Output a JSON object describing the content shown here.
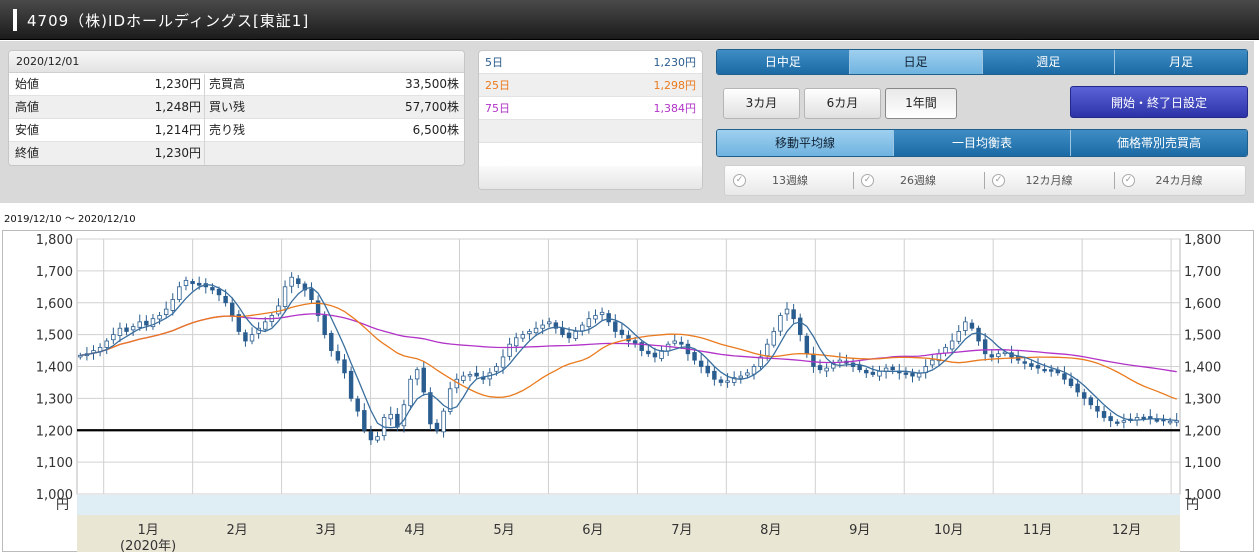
{
  "header": {
    "title": "4709（株)IDホールディングス[東証1]"
  },
  "quote": {
    "date": "2020/12/01",
    "rows": [
      {
        "label": "始値",
        "value": "1,230円",
        "label2": "売買高",
        "value2": "33,500株"
      },
      {
        "label": "高値",
        "value": "1,248円",
        "label2": "買い残",
        "value2": "57,700株"
      },
      {
        "label": "安値",
        "value": "1,214円",
        "label2": "売り残",
        "value2": "6,500株"
      },
      {
        "label": "終値",
        "value": "1,230円",
        "label2": "",
        "value2": ""
      }
    ]
  },
  "moving_averages": [
    {
      "label": "5日",
      "value": "1,230円",
      "color": "#2a5d8f"
    },
    {
      "label": "25日",
      "value": "1,298円",
      "color": "#ea7a1e"
    },
    {
      "label": "75日",
      "value": "1,384円",
      "color": "#b233c8"
    }
  ],
  "period_tabs": [
    "日中足",
    "日足",
    "週足",
    "月足"
  ],
  "period_tab_active": "日足",
  "range_buttons": [
    "3カ月",
    "6カ月",
    "1年間"
  ],
  "range_active": "1年間",
  "set_button": "開始・終了日設定",
  "indicator_tabs": [
    "移動平均線",
    "一目均衡表",
    "価格帯別売買高"
  ],
  "indicator_active": "移動平均線",
  "ma_options": [
    "13週線",
    "26週線",
    "12カ月線",
    "24カ月線"
  ],
  "date_range": "2019/12/10 〜 2020/12/10",
  "colors": {
    "up": "#ffffff",
    "down": "#2a5d8f",
    "ma5": "#3a6f9f",
    "ma25": "#ea7a1e",
    "ma75": "#b233c8",
    "reference": "#000000",
    "axis_band": "#dfeef5",
    "month_band": "#e9e6d4"
  },
  "chart_data": {
    "type": "candlestick",
    "y_unit": "円",
    "ylim": [
      1000,
      1800
    ],
    "yticks": [
      "1,000",
      "1,100",
      "1,200",
      "1,300",
      "1,400",
      "1,500",
      "1,600",
      "1,700",
      "1,800"
    ],
    "reference_line": 1200,
    "year_label": "(2020年)",
    "months": [
      "1月",
      "2月",
      "3月",
      "4月",
      "5月",
      "6月",
      "7月",
      "8月",
      "9月",
      "10月",
      "11月",
      "12月"
    ],
    "close": [
      1435,
      1440,
      1450,
      1460,
      1480,
      1500,
      1520,
      1510,
      1525,
      1540,
      1530,
      1550,
      1560,
      1580,
      1610,
      1650,
      1670,
      1660,
      1655,
      1650,
      1640,
      1625,
      1600,
      1560,
      1510,
      1480,
      1500,
      1520,
      1540,
      1560,
      1590,
      1650,
      1680,
      1660,
      1640,
      1610,
      1560,
      1500,
      1450,
      1420,
      1380,
      1300,
      1260,
      1200,
      1170,
      1180,
      1240,
      1250,
      1210,
      1280,
      1360,
      1390,
      1320,
      1220,
      1200,
      1260,
      1330,
      1360,
      1370,
      1375,
      1370,
      1360,
      1380,
      1400,
      1430,
      1470,
      1490,
      1500,
      1510,
      1520,
      1530,
      1540,
      1520,
      1500,
      1490,
      1510,
      1530,
      1550,
      1560,
      1570,
      1540,
      1510,
      1500,
      1480,
      1470,
      1450,
      1440,
      1430,
      1450,
      1470,
      1480,
      1470,
      1440,
      1420,
      1400,
      1380,
      1360,
      1350,
      1355,
      1365,
      1370,
      1380,
      1400,
      1430,
      1470,
      1510,
      1560,
      1580,
      1550,
      1500,
      1440,
      1400,
      1390,
      1395,
      1410,
      1420,
      1410,
      1400,
      1390,
      1380,
      1375,
      1385,
      1395,
      1390,
      1380,
      1375,
      1370,
      1380,
      1400,
      1420,
      1440,
      1460,
      1480,
      1510,
      1540,
      1520,
      1480,
      1440,
      1430,
      1440,
      1445,
      1430,
      1420,
      1410,
      1400,
      1395,
      1390,
      1385,
      1380,
      1360,
      1340,
      1320,
      1300,
      1280,
      1260,
      1240,
      1230,
      1225,
      1230,
      1235,
      1240,
      1238,
      1235,
      1232,
      1230,
      1228,
      1230
    ],
    "ma5_last": 1230,
    "ma25_last": 1298,
    "ma75_last": 1384
  }
}
